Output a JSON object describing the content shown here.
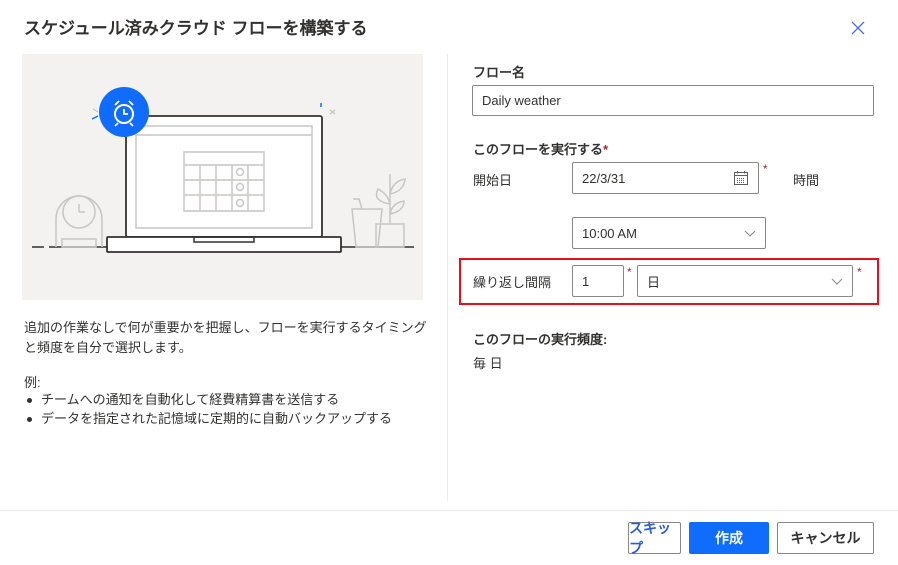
{
  "dialog": {
    "title": "スケジュール済みクラウド フローを構築する",
    "close_icon": "close-icon"
  },
  "left": {
    "description": "追加の作業なしで何が重要かを把握し、フローを実行するタイミングと頻度を自分で選択します。",
    "examples_label": "例:",
    "examples": [
      "チームへの通知を自動化して経費精算書を送信する",
      "データを指定された記憶域に定期的に自動バックアップする"
    ],
    "illustration": "laptop-calendar-alarm-illustration"
  },
  "form": {
    "flow_name_label": "フロー名",
    "flow_name_value": "Daily weather",
    "run_label": "このフローを実行する",
    "required_mark": "*",
    "start_date_label": "開始日",
    "start_date_value": "22/3/31",
    "time_label": "時間",
    "time_value": "10:00 AM",
    "repeat_label": "繰り返し間隔",
    "repeat_count": "1",
    "repeat_unit": "日",
    "frequency_label": "このフローの実行頻度:",
    "frequency_value": "毎 日"
  },
  "footer": {
    "skip_label": "スキップ",
    "create_label": "作成",
    "cancel_label": "キャンセル"
  },
  "colors": {
    "accent": "#0f6cfd",
    "required": "#a4262c",
    "highlight": "#e0101e"
  }
}
